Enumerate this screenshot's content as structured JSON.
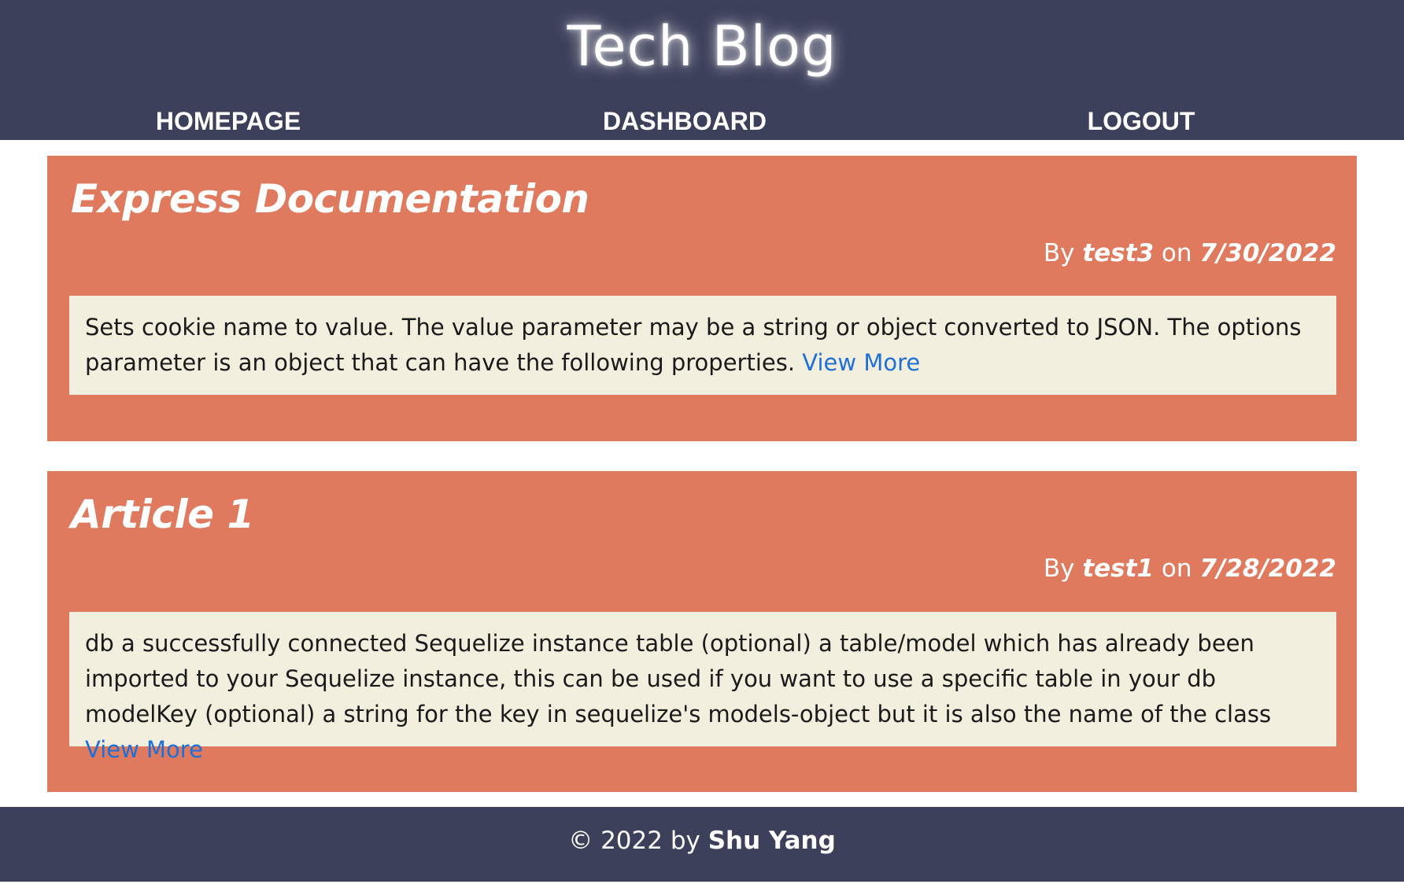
{
  "header": {
    "title": "Tech Blog",
    "nav": {
      "home": "HOMEPAGE",
      "dashboard": "DASHBOARD",
      "logout": "LOGOUT"
    }
  },
  "posts": [
    {
      "title": "Express Documentation",
      "by_label": "By",
      "author": "test3",
      "on_label": "on",
      "date": "7/30/2022",
      "excerpt": "Sets cookie name to value. The value parameter may be a string or object converted to JSON. The options parameter is an object that can have the following properties.",
      "view_more": "View More"
    },
    {
      "title": "Article 1",
      "by_label": "By",
      "author": "test1",
      "on_label": "on",
      "date": "7/28/2022",
      "excerpt": "db a successfully connected Sequelize instance table (optional) a table/model which has already been imported to your Sequelize instance, this can be used if you want to use a specific table in your db modelKey (optional) a string for the key in sequelize's models-object but it is also the name of the class",
      "view_more": "View More"
    }
  ],
  "footer": {
    "copyright": "© 2022 by",
    "author": "Shu Yang"
  },
  "colors": {
    "header_bg": "#3d405b",
    "post_bg": "#e07a5f",
    "post_body_bg": "#f2efde",
    "link": "#1f6fd6"
  }
}
